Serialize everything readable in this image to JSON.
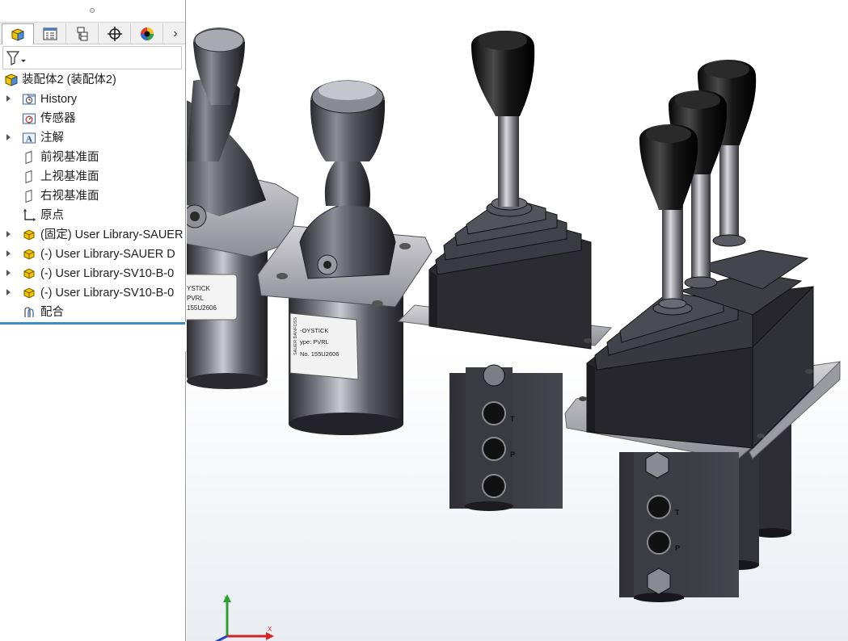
{
  "tree": {
    "root": {
      "label": "装配体2 (装配体2)",
      "icon": "assembly-icon"
    },
    "items": [
      {
        "label": "History",
        "icon": "history-icon",
        "expandable": true
      },
      {
        "label": "传感器",
        "icon": "sensor-icon",
        "expandable": false
      },
      {
        "label": "注解",
        "icon": "annotation-icon",
        "expandable": true
      },
      {
        "label": "前视基准面",
        "icon": "plane-icon",
        "expandable": false
      },
      {
        "label": "上视基准面",
        "icon": "plane-icon",
        "expandable": false
      },
      {
        "label": "右视基准面",
        "icon": "plane-icon",
        "expandable": false
      },
      {
        "label": "原点",
        "icon": "origin-icon",
        "expandable": false
      },
      {
        "label": "(固定) User Library-SAUER",
        "icon": "component-icon",
        "expandable": true
      },
      {
        "label": "(-) User Library-SAUER D",
        "icon": "component-icon",
        "expandable": true
      },
      {
        "label": "(-) User Library-SV10-B-0",
        "icon": "component-icon",
        "expandable": true
      },
      {
        "label": "(-) User Library-SV10-B-0",
        "icon": "component-icon",
        "expandable": true
      },
      {
        "label": "配合",
        "icon": "mates-icon",
        "expandable": false
      }
    ]
  },
  "tabs": [
    {
      "icon": "feature-manager-icon",
      "active": true
    },
    {
      "icon": "property-manager-icon",
      "active": false
    },
    {
      "icon": "configuration-manager-icon",
      "active": false
    },
    {
      "icon": "dimxpert-icon",
      "active": false
    },
    {
      "icon": "display-manager-icon",
      "active": false
    }
  ],
  "model": {
    "label_1": {
      "line1": "YSTICK",
      "line2": "PVRL",
      "line3": "155U2606"
    },
    "label_2": {
      "line1": "-OYSTICK",
      "line2": "ype: PVRL",
      "line3": "No.   155U2606",
      "side": "SAUER DANFOSS"
    },
    "ports": {
      "t": "T",
      "p": "P"
    }
  },
  "triad": {
    "y": "Y",
    "x": "X"
  },
  "colors": {
    "selection": "#3c8fc8",
    "component": "#f2c300",
    "metal": "#4a4a50"
  }
}
